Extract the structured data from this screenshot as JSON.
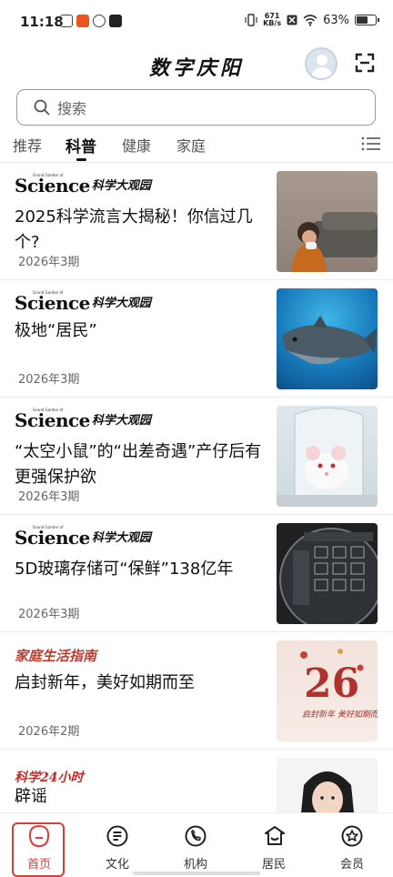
{
  "status_bar": {
    "time": "11:18",
    "net_speed_value": "671",
    "net_speed_unit": "KB/s",
    "battery_percent": "63%",
    "battery_level": 0.63
  },
  "header": {
    "app_title": "数字庆阳"
  },
  "search": {
    "placeholder": "搜索"
  },
  "tabs": [
    {
      "label": "推荐",
      "active": false
    },
    {
      "label": "科普",
      "active": true
    },
    {
      "label": "健康",
      "active": false
    },
    {
      "label": "家庭",
      "active": false
    }
  ],
  "articles": [
    {
      "brand": "Science",
      "brand_cn": "科学大观园",
      "brand_tiny": "Grand Garden of",
      "title": "2025科学流言大揭秘！你信过几个?",
      "date": "2026年3期"
    },
    {
      "brand": "Science",
      "brand_cn": "科学大观园",
      "brand_tiny": "Grand Garden of",
      "title": "极地“居民”",
      "date": "2026年3期"
    },
    {
      "brand": "Science",
      "brand_cn": "科学大观园",
      "brand_tiny": "Grand Garden of",
      "title": "“太空小鼠”的“出差奇遇”产仔后有更强保护欲",
      "date": "2026年3期"
    },
    {
      "brand": "Science",
      "brand_cn": "科学大观园",
      "brand_tiny": "Grand Garden of",
      "title": "5D玻璃存储可“保鲜”138亿年",
      "date": "2026年3期"
    },
    {
      "brand_family": "家庭生活指南",
      "title": "启封新年，美好如期而至",
      "date": "2026年2期",
      "thumb_text_big": "26",
      "thumb_text_small": "启封新年 美好如期而至"
    },
    {
      "brand_logo": "科学24小时",
      "title": "辟谣",
      "date": ""
    }
  ],
  "bottom_nav": [
    {
      "label": "首页",
      "icon": "home-icon",
      "active": true
    },
    {
      "label": "文化",
      "icon": "culture-icon",
      "active": false
    },
    {
      "label": "机构",
      "icon": "phone-icon",
      "active": false
    },
    {
      "label": "居民",
      "icon": "residents-icon",
      "active": false
    },
    {
      "label": "会员",
      "icon": "member-icon",
      "active": false
    }
  ],
  "colors": {
    "accent": "#e53935",
    "family_brand": "#c0392b"
  }
}
